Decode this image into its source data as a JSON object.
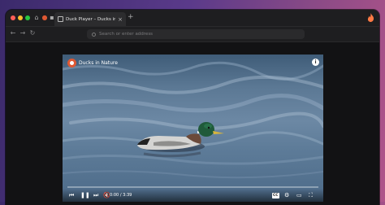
{
  "browser": {
    "tab": {
      "title": "Duck Player – Ducks in Nature",
      "close_icon": "close-icon"
    },
    "new_tab_label": "+",
    "address": {
      "placeholder": "Search or enter address"
    }
  },
  "player": {
    "title": "Ducks in Nature",
    "info_label": "i",
    "time": "0:00 / 3:39",
    "progress": 0.0,
    "cc_label": "CC",
    "controls": [
      "skip-back-icon",
      "pause-icon",
      "skip-forward-icon",
      "mute-icon",
      "cc-icon",
      "gear-icon",
      "cast-icon",
      "fullscreen-icon"
    ]
  },
  "colors": {
    "accent": "#de5833",
    "background": "#151517"
  }
}
